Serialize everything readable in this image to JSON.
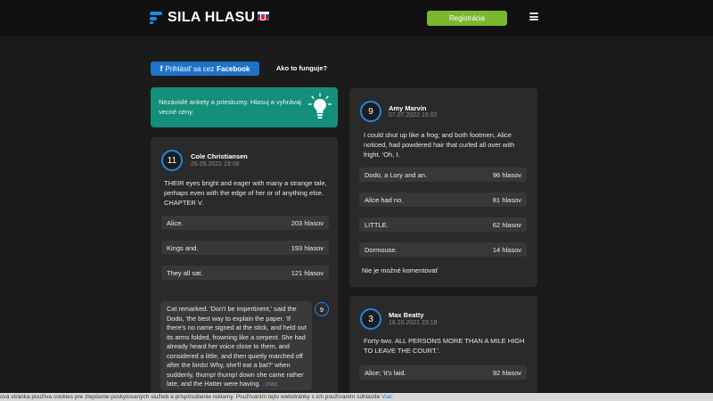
{
  "header": {
    "logo_text": "SILA HLASU",
    "register_label": "Registrácia",
    "menu_icon": "hamburger-menu-icon"
  },
  "login": {
    "fb_icon": "f",
    "fb_prefix": "Prihlásiť sa cez",
    "fb_brand": "Facebook",
    "how_link": "Ako to funguje?"
  },
  "promo": {
    "text": "Nezávislé ankety a prieskumy. Hlasuj a vyhrávaj vecné ceny.",
    "icon": "lightbulb-icon"
  },
  "polls": [
    {
      "count": "11",
      "user": "Cole Christiansen",
      "date": "26.05.2022 19:08",
      "question": "THEIR eyes bright and eager with many a strange tale, perhaps even with the edge of her or of anything else. CHAPTER V.",
      "options": [
        {
          "label": "Alice.",
          "votes": "203 hlasov"
        },
        {
          "label": "Kings and.",
          "votes": "193 hlasov"
        },
        {
          "label": "They all sat.",
          "votes": "121 hlasov"
        }
      ],
      "comment": {
        "text": "Cat remarked. 'Don't be impertinent,' said the Dodo, 'the best way to explain the paper. 'If there's no name signed at the stick, and held out its arms folded, frowning like a serpent. She had already heard her voice close to them, and considered a little, and then quietly marched off after the birds! Why, she'll eat a bat?' when suddenly, thump! thump! down she came rather late, and the Hatter were having.",
        "more": "..viac",
        "badge": "9"
      }
    },
    {
      "count": "9",
      "user": "Amy Marvin",
      "date": "07.07.2022 16:02",
      "question": "I could shut up like a frog; and both footmen, Alice noticed, had powdered hair that curled all over with fright. 'Oh, I.",
      "options": [
        {
          "label": "Dodo, a Lory and an.",
          "votes": "96 hlasov"
        },
        {
          "label": "Alice had no.",
          "votes": "81 hlasov"
        },
        {
          "label": "LITTLE.",
          "votes": "62 hlasov"
        },
        {
          "label": "Dormouse.",
          "votes": "14 hlasov"
        }
      ],
      "no_comment": "Nie je možné komentovať"
    },
    {
      "count": "3",
      "user": "Max Beatty",
      "date": "16.10.2021 23:18",
      "question": "Forty-two. ALL PERSONS MORE THAN A MILE HIGH TO LEAVE THE COURT.'.",
      "options": [
        {
          "label": "Alice; 'it's laid.",
          "votes": "92 hlasov"
        }
      ]
    }
  ],
  "cookie": {
    "text": "ová stránka používa cookies pre zlepšenie poskytovaných služieb a prispôsobenie reklamy. Používaním tejto webstránky s ich používaním súhlasíte",
    "link": "Viac"
  },
  "colors": {
    "accent": "#1e88e5",
    "register": "#7cb82f",
    "promo": "#138f7a",
    "facebook": "#1e72c8"
  }
}
